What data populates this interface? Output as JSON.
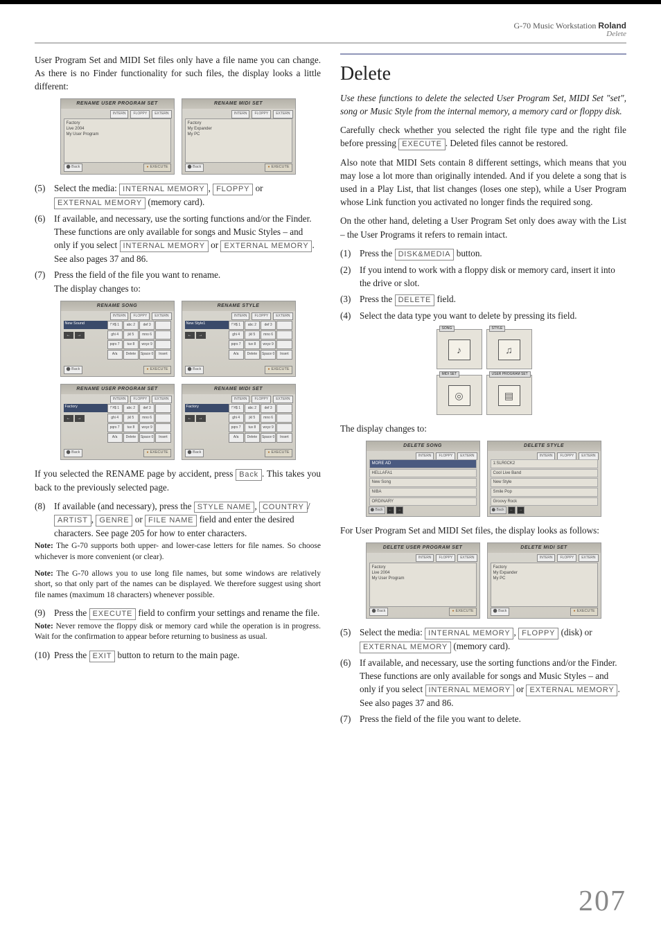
{
  "header": {
    "product": "G-70 Music Workstation",
    "brand": "Roland",
    "section": "Delete"
  },
  "left": {
    "intro": "User Program Set and MIDI Set files only have a file name you can change. As there is no Finder functionality for such files, the display looks a little different:",
    "shots1": {
      "a": {
        "title": "RENAME USER PROGRAM SET",
        "list": "Factory\nLive 2004\nMy User Program"
      },
      "b": {
        "title": "RENAME MIDI SET",
        "list": "Factory\nMy Expander\nMy PC"
      }
    },
    "step5": {
      "num": "(5)",
      "pre": "Select the media: ",
      "b1": "INTERNAL MEMORY",
      "mid1": ", ",
      "b2": "FLOPPY",
      "mid2": " or ",
      "b3": "EXTERNAL MEMORY",
      "post": " (memory card)."
    },
    "step6": {
      "num": "(6)",
      "line1": "If available, and necessary, use the sorting functions and/or the Finder.",
      "line2a": "These functions are only available for songs and Music Styles – and only if you select ",
      "b1": "INTERNAL MEMORY",
      "mid": " or ",
      "b2": "EXTERNAL MEMORY",
      "line2b": ". See also pages 37 and 86."
    },
    "step7": {
      "num": "(7)",
      "line1": "Press the field of the file you want to rename.",
      "line2": "The display changes to:"
    },
    "shots2": {
      "a": {
        "title": "RENAME SONG",
        "name": "New Sound"
      },
      "b": {
        "title": "RENAME STYLE",
        "name": "New Style1"
      },
      "c": {
        "title": "RENAME USER PROGRAM SET",
        "name": "Factory"
      },
      "d": {
        "title": "RENAME MIDI SET",
        "name": "Factory"
      }
    },
    "keypad": [
      "!\"#$ 1",
      "abc 2",
      "def 3",
      "ghi 4",
      "jkl 5",
      "mno 6",
      "pqrs 7",
      "tuv 8",
      "wxyz 9",
      "A/a",
      "Delete",
      "Space 0",
      "Insert"
    ],
    "afterShots": {
      "pre": "If you selected the RENAME page by accident, press ",
      "btn": "Back",
      "post": ". This takes you back to the previously selected page."
    },
    "step8": {
      "num": "(8)",
      "line1": "If available (and necessary), press the ",
      "b1": "STYLE NAME",
      "s1": ", ",
      "b2": "COUNTRY",
      "s2": "/",
      "b3": "ARTIST",
      "s3": ", ",
      "b4": "GENRE",
      "s4": " or ",
      "b5": "FILE NAME",
      "line2": " field and enter the desired characters. See page 205 for how to enter characters."
    },
    "note1": {
      "label": "Note:",
      "text": " The G-70 supports both upper- and lower-case letters for file names. So choose whichever is more convenient (or clear)."
    },
    "note2": {
      "label": "Note:",
      "text": " The G-70 allows you to use long file names, but some windows are relatively short, so that only part of the names can be displayed. We therefore suggest using short file names (maximum 18 characters) whenever possible."
    },
    "step9": {
      "num": "(9)",
      "pre": "Press the ",
      "btn": "EXECUTE",
      "post": " field to confirm your settings and rename the file."
    },
    "note3": {
      "label": "Note:",
      "text": " Never remove the floppy disk or memory card while the operation is in progress. Wait for the confirmation to appear before returning to business as usual."
    },
    "step10": {
      "num": "(10)",
      "pre": "Press the ",
      "btn": "EXIT",
      "post": " button to return to the main page."
    },
    "shotbtn": {
      "back": "⬤ Back",
      "exec": "EXECUTE",
      "tabs": [
        "INTERN",
        "FLOPPY",
        "EXTERN"
      ]
    }
  },
  "right": {
    "title": "Delete",
    "intro": "Use these functions to delete the selected User Program Set, MIDI Set \"set\", song or Music Style from the internal memory, a memory card or floppy disk.",
    "p1a": "Carefully check whether you selected the right file type and the right file before pressing ",
    "p1btn": "EXECUTE",
    "p1b": ". Deleted files cannot be restored.",
    "p2": "Also note that MIDI Sets contain 8 different settings, which means that you may lose a lot more than originally intended. And if you delete a song that is used in a Play List, that list changes (loses one step), while a User Program whose Link function you activated no longer finds the required song.",
    "p3": "On the other hand, deleting a User Program Set only does away with the List – the User Programs it refers to remain intact.",
    "step1": {
      "num": "(1)",
      "pre": "Press the ",
      "btn": "DISK&MEDIA",
      "post": " button."
    },
    "step2": {
      "num": "(2)",
      "text": "If you intend to work with a floppy disk or memory card, insert it into the drive or slot."
    },
    "step3": {
      "num": "(3)",
      "pre": "Press the ",
      "btn": "DELETE",
      "post": " field."
    },
    "step4": {
      "num": "(4)",
      "text": "Select the data type you want to delete by pressing its field."
    },
    "icons": {
      "a": "SONG",
      "b": "STYLE",
      "c": "MIDI SET",
      "d": "USER PROGRAM SET"
    },
    "afterIcons": "The display changes to:",
    "delshots1": {
      "a": {
        "title": "DELETE SONG",
        "rows": [
          "MORE AD",
          "HELLAFA1",
          "New Song",
          "NIBA",
          "ORDINARY"
        ]
      },
      "b": {
        "title": "DELETE STYLE",
        "rows": [
          "1:SLR0CK2",
          "Cool Live Band",
          "New Style",
          "Smile Pop",
          "Groovy Rock"
        ]
      }
    },
    "p4": "For User Program Set and MIDI Set files, the display looks as follows:",
    "delshots2": {
      "a": {
        "title": "DELETE USER PROGRAM SET",
        "list": "Factory\nLive 2004\nMy User Program"
      },
      "b": {
        "title": "DELETE MIDI SET",
        "list": "Factory\nMy Expander\nMy PC"
      }
    },
    "step5": {
      "num": "(5)",
      "pre": "Select the media: ",
      "b1": "INTERNAL MEMORY",
      "mid1": ", ",
      "b2": "FLOPPY",
      "mid2": " (disk) or ",
      "b3": "EXTERNAL MEMORY",
      "post": " (memory card)."
    },
    "step6": {
      "num": "(6)",
      "line1": "If available, and necessary, use the sorting functions and/or the Finder.",
      "line2a": "These functions are only available for songs and Music Styles – and only if you select ",
      "b1": "INTERNAL MEMORY",
      "mid": " or ",
      "b2": "EXTERNAL MEMORY",
      "line2b": ". See also pages 37 and 86."
    },
    "step7": {
      "num": "(7)",
      "text": "Press the field of the file you want to delete."
    }
  },
  "pagenum": "207"
}
